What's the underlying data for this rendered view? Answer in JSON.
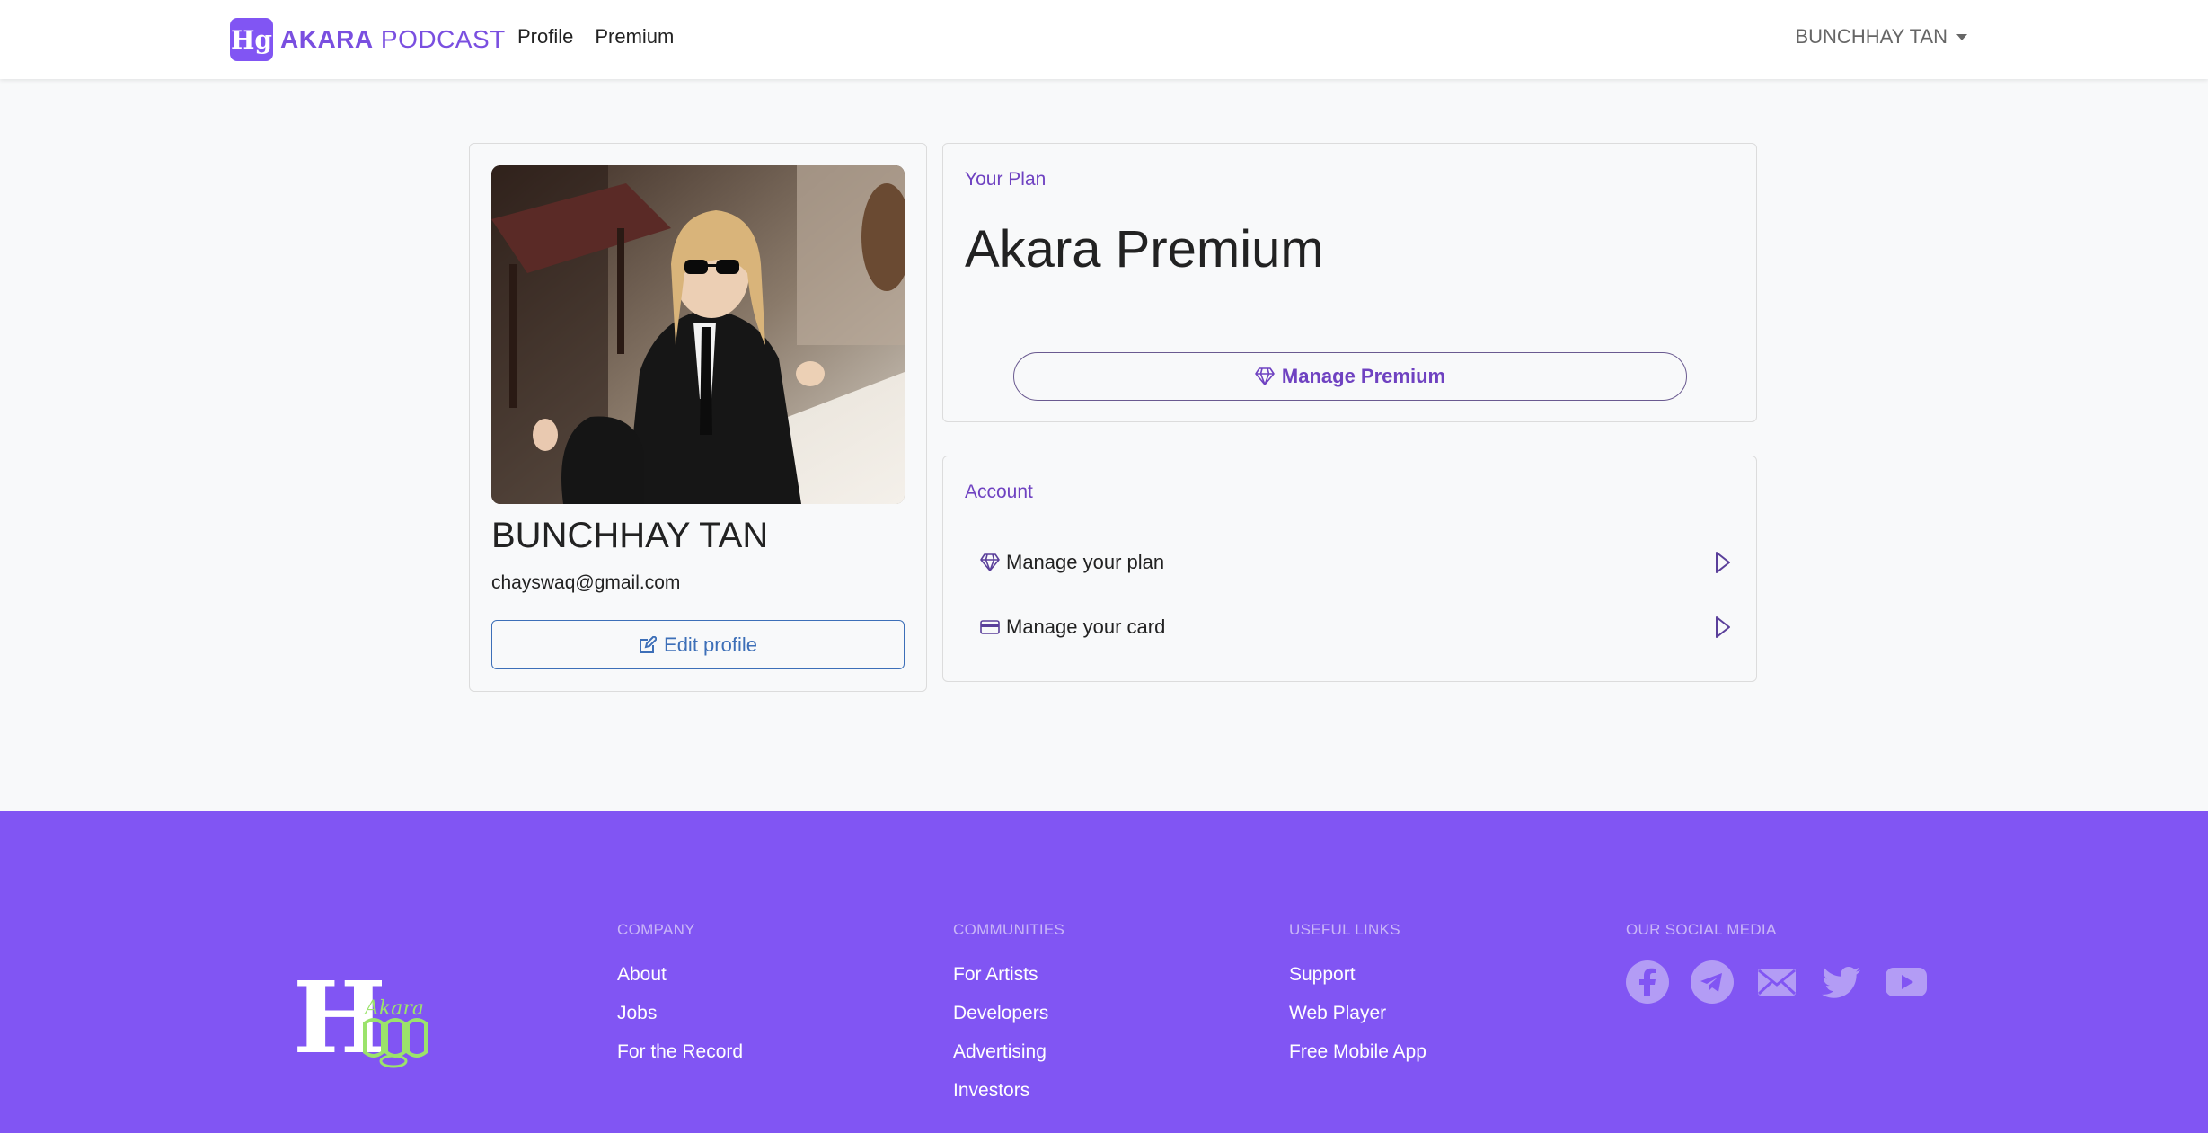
{
  "navbar": {
    "brand_logo_text": "Hg",
    "brand_bold": "AKARA",
    "brand_light": "PODCAST",
    "links": [
      {
        "label": "Profile"
      },
      {
        "label": "Premium"
      }
    ],
    "user_name": "BUNCHHAY TAN"
  },
  "profile": {
    "name": "BUNCHHAY TAN",
    "email": "chayswaq@gmail.com",
    "edit_label": "Edit profile"
  },
  "plan": {
    "label": "Your Plan",
    "title": "Akara Premium",
    "button_label": "Manage Premium"
  },
  "account": {
    "label": "Account",
    "rows": [
      {
        "label": "Manage your plan",
        "icon": "gem-icon"
      },
      {
        "label": "Manage your card",
        "icon": "credit-card-icon"
      }
    ]
  },
  "footer": {
    "logo_text": "Akara",
    "company": {
      "heading": "COMPANY",
      "links": [
        "About",
        "Jobs",
        "For the Record"
      ]
    },
    "communities": {
      "heading": "COMMUNITIES",
      "links": [
        "For Artists",
        "Developers",
        "Advertising",
        "Investors"
      ]
    },
    "useful_links": {
      "heading": "USEFUL LINKS",
      "links": [
        "Support",
        "Web Player",
        "Free Mobile App"
      ]
    },
    "social": {
      "heading": "OUR SOCIAL MEDIA",
      "icons": [
        "facebook-icon",
        "telegram-icon",
        "mail-icon",
        "twitter-icon",
        "youtube-icon"
      ]
    }
  },
  "colors": {
    "accent": "#6f42c1",
    "footer_bg": "#8155f3",
    "edit_blue": "#3d6fb8"
  }
}
